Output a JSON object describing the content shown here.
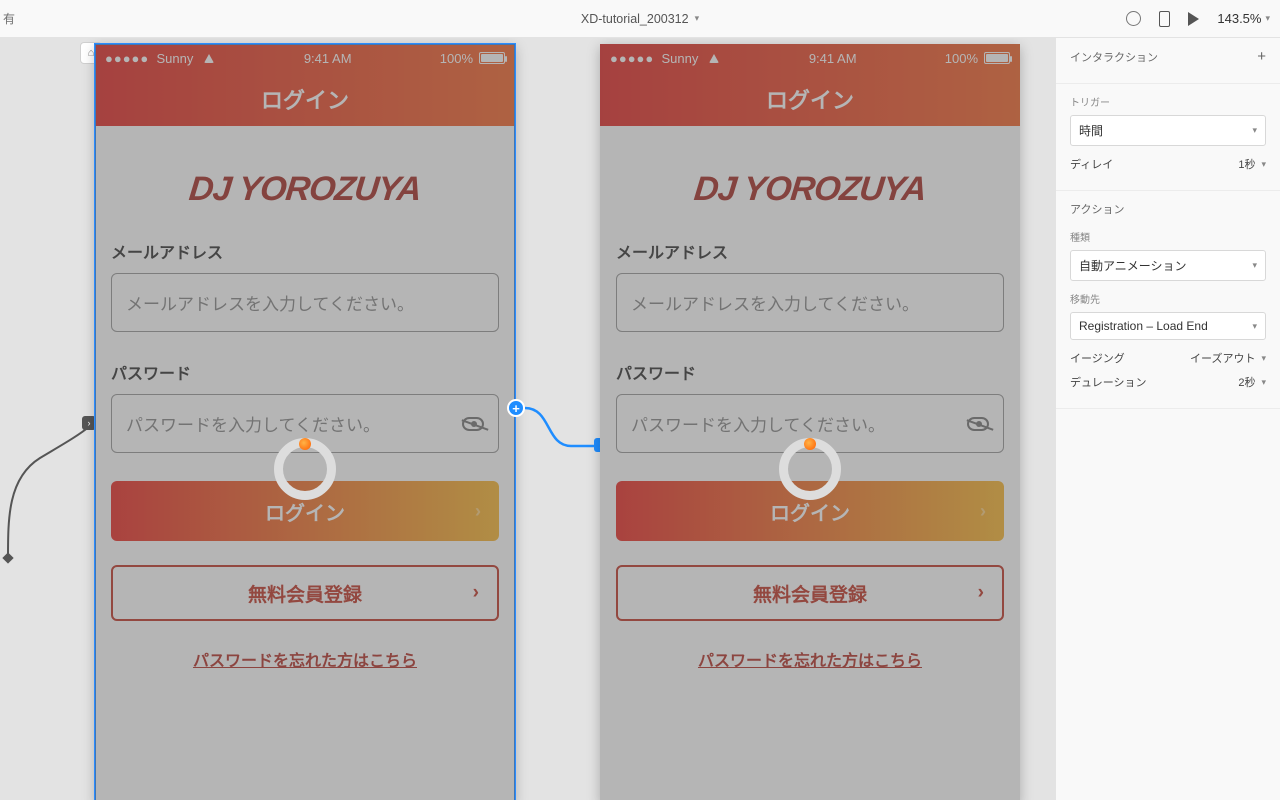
{
  "topbar": {
    "share_label": "有",
    "doc_title": "XD-tutorial_200312",
    "zoom_label": "143.5%"
  },
  "sidebar": {
    "interaction_header": "インタラクション",
    "trigger_label": "トリガー",
    "trigger_value": "時間",
    "delay_label": "ディレイ",
    "delay_value": "1秒",
    "action_header": "アクション",
    "type_label": "種類",
    "type_value": "自動アニメーション",
    "destination_label": "移動先",
    "destination_value": "Registration – Load End",
    "easing_label": "イージング",
    "easing_value": "イーズアウト",
    "duration_label": "デュレーション",
    "duration_value": "2秒"
  },
  "artboard": {
    "status": {
      "carrier_dots": "●●●●●",
      "carrier": "Sunny",
      "time": "9:41 AM",
      "battery": "100%"
    },
    "title": "ログイン",
    "logo": "DJ YOROZUYA",
    "email_label": "メールアドレス",
    "email_placeholder": "メールアドレスを入力してください。",
    "password_label": "パスワード",
    "password_placeholder": "パスワードを入力してください。",
    "login_btn": "ログイン",
    "signup_btn": "無料会員登録",
    "forgot_link": "パスワードを忘れた方はこちら"
  }
}
